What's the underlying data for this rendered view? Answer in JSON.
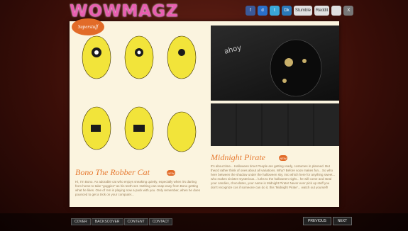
{
  "app": {
    "logo": "WOWMAGZ"
  },
  "social": [
    {
      "icon": "facebook-icon",
      "label": "f",
      "color": "#3b5998"
    },
    {
      "icon": "delicious-icon",
      "label": "d",
      "color": "#2a6fc9"
    },
    {
      "icon": "twitter-icon",
      "label": "t",
      "color": "#3aa7d8"
    },
    {
      "icon": "digg-icon",
      "label": "Dk",
      "color": "#2a79b8"
    },
    {
      "icon": "stumble-icon",
      "label": "Stumble",
      "color": "#e0e0e0"
    },
    {
      "icon": "reddit-icon",
      "label": "Reddit",
      "color": "#e0e0e0"
    },
    {
      "icon": "share-icon",
      "label": "",
      "color": "#e0e0e0"
    },
    {
      "icon": "close-icon",
      "label": "X",
      "color": "#777"
    }
  ],
  "magazine": {
    "badge": "Superstuff",
    "left_title": "Bono The Robber Cat",
    "right_title": "Midnight Pirate",
    "left_body": "Hi, I'm Bono. An adorable cat who enjoys sneaking quietly, especially when it's darting from home to take \"goggies\" as his teeth set. Nothing can snap easy from Bono getting what he likes. One of 'em is playing now a pack with you. Only remember, when he does pounced to get a trick on your computer...",
    "right_body": "It's about time... Halloween time! People are getting ready, costumes in planned. But they'd rather think of ones about all variations. Why? Before soon makes fun... So who here between the shadow under the halloween sky, into which here for anything sweet... who makes sinister mysterious... lurks to the halloween night... he will come and steal your candies, chocolates, your name is Midnight Pirate! Never ever pick up stuff you don't recognize cos if someone can do it, this 'Midnight Pirate'... watch out yourself!",
    "left_tag": "NEW",
    "right_tag": "NEW"
  },
  "nav": {
    "items": [
      "COVER",
      "BACKSCOVER",
      "CONTENT",
      "CONTACT"
    ],
    "previous": "PREVIOUS",
    "next": "NEXT"
  }
}
